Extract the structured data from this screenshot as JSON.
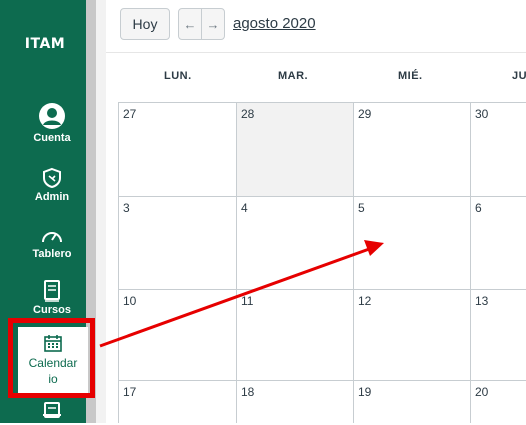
{
  "sidebar": {
    "logo": "ITAM",
    "items": [
      {
        "label": "Cuenta",
        "icon": "user-icon"
      },
      {
        "label": "Admin",
        "icon": "shield-icon"
      },
      {
        "label": "Tablero",
        "icon": "gauge-icon"
      },
      {
        "label": "Cursos",
        "icon": "book-icon"
      },
      {
        "label": "Calendar io",
        "icon": "calendar-icon",
        "active": true
      },
      {
        "label": "",
        "icon": "inbox-icon"
      }
    ]
  },
  "toolbar": {
    "today_label": "Hoy",
    "prev_label": "←",
    "next_label": "→",
    "month_title": "agosto 2020"
  },
  "calendar": {
    "weekdays": [
      "LUN.",
      "MAR.",
      "MIÉ.",
      "JU"
    ],
    "weeks": [
      [
        "27",
        "28",
        "29",
        "30"
      ],
      [
        "3",
        "4",
        "5",
        "6"
      ],
      [
        "10",
        "11",
        "12",
        "13"
      ],
      [
        "17",
        "18",
        "19",
        "20"
      ]
    ]
  },
  "annotation": {
    "highlight_color": "#e60000"
  }
}
